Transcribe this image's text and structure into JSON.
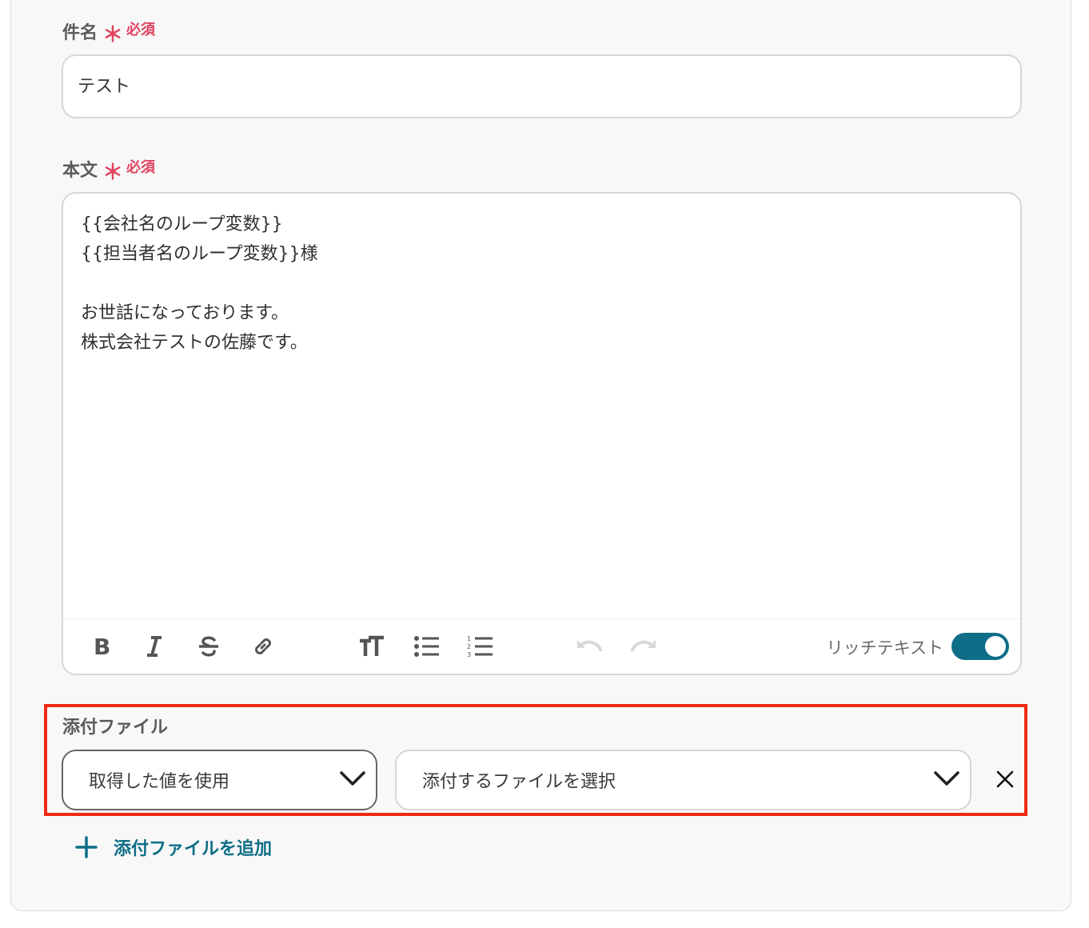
{
  "subject": {
    "label": "件名",
    "required_mark": "＊",
    "required_text": "必須",
    "value": "テスト"
  },
  "body": {
    "label": "本文",
    "required_mark": "＊",
    "required_text": "必須",
    "value": "{{会社名のループ変数}}\n{{担当者名のループ変数}}様\n\nお世話になっております。\n株式会社テストの佐藤です。"
  },
  "toolbar": {
    "icons": [
      "bold-icon",
      "italic-icon",
      "strikethrough-icon",
      "link-icon",
      "text-size-icon",
      "bullet-list-icon",
      "numbered-list-icon",
      "undo-icon",
      "redo-icon"
    ],
    "rich_text_label": "リッチテキスト",
    "rich_text_enabled": true
  },
  "attachment": {
    "label": "添付ファイル",
    "source_select_value": "取得した値を使用",
    "file_select_placeholder": "添付するファイルを選択",
    "add_label": "添付ファイルを追加"
  },
  "colors": {
    "accent": "#0f6e87",
    "required": "#e0435f",
    "highlight": "#ee2a12"
  }
}
